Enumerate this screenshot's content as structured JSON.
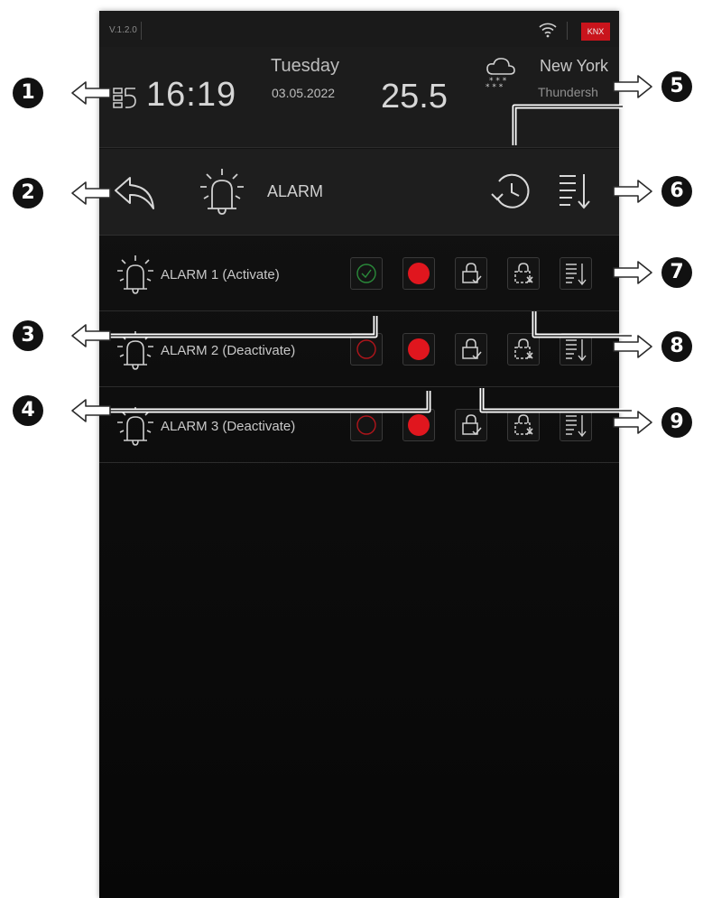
{
  "status_bar": {
    "version": "V.1.2.0",
    "knx_label": "KNX",
    "knx_color": "#c9141c",
    "wifi_icon": "wifi-icon"
  },
  "header": {
    "menu_icon": "list-menu-icon",
    "time": "16:19",
    "weekday": "Tuesday",
    "date": "03.05.2022",
    "temperature": "25.5",
    "weather_icon": "cloud-snow-icon",
    "city": "New York",
    "condition": "Thundersh"
  },
  "toolbar": {
    "back_icon": "back-arrow-icon",
    "section_icon": "siren-icon",
    "title": "ALARM",
    "history_icon": "history-clock-icon",
    "sort_icon": "sort-list-icon"
  },
  "alarms": [
    {
      "label": "ALARM 1 (Activate)",
      "state_icon": "check-circle-icon",
      "state_color": "#2a8a3a",
      "indicator_color": "#e0161e",
      "buttons": [
        "check-circle-icon",
        "record-dot-icon",
        "lock-check-icon",
        "lock-cross-icon",
        "sort-list-icon"
      ]
    },
    {
      "label": "ALARM 2 (Deactivate)",
      "state_icon": "empty-circle-icon",
      "state_color": "#b0151b",
      "indicator_color": "#e0161e",
      "buttons": [
        "empty-circle-icon",
        "record-dot-icon",
        "lock-check-icon",
        "lock-cross-icon",
        "sort-list-icon"
      ]
    },
    {
      "label": "ALARM 3 (Deactivate)",
      "state_icon": "empty-circle-icon",
      "state_color": "#b0151b",
      "indicator_color": "#e0161e",
      "buttons": [
        "empty-circle-icon",
        "record-dot-icon",
        "lock-check-icon",
        "lock-cross-icon",
        "sort-list-icon"
      ]
    }
  ],
  "callouts": [
    "1",
    "2",
    "3",
    "4",
    "5",
    "6",
    "7",
    "8",
    "9"
  ]
}
